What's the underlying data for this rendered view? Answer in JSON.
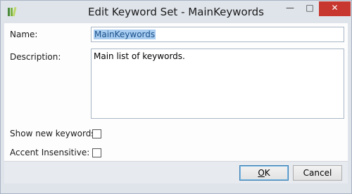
{
  "window": {
    "title": "Edit Keyword Set - MainKeywords",
    "controls": {
      "minimize_glyph": "—",
      "maximize_glyph": "□",
      "close_glyph": "✕"
    }
  },
  "icons": {
    "app_icon": "keyword-set-icon",
    "minimize": "minimize-icon",
    "maximize": "maximize-icon",
    "close": "close-icon"
  },
  "colors": {
    "close_button": "#c7372f",
    "selection": "#a8cdf0",
    "default_button_border": "#3c7fb1"
  },
  "form": {
    "name_label": "Name:",
    "name_value": "MainKeywords",
    "description_label": "Description:",
    "description_value": "Main list of keywords.",
    "show_new_keywords_label": "Show new keywords:",
    "show_new_keywords_checked": false,
    "accent_insensitive_label": "Accent Insensitive:",
    "accent_insensitive_checked": false
  },
  "buttons": {
    "ok_label_underlined": "O",
    "ok_label_rest": "K",
    "cancel_label": "Cancel"
  }
}
